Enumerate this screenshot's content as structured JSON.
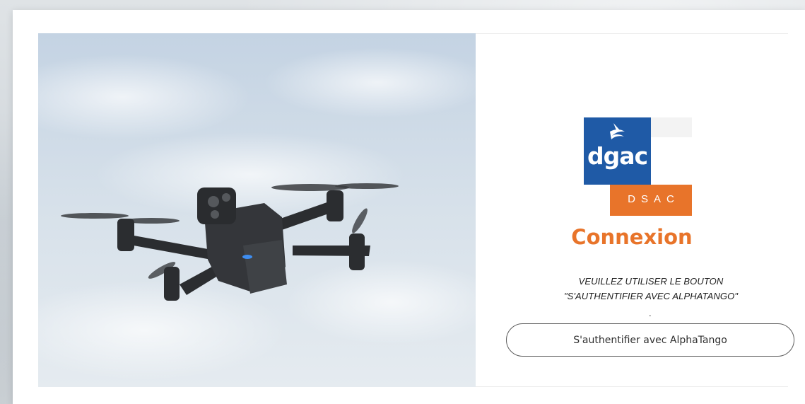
{
  "logo": {
    "primary_text": "dgac",
    "secondary_text": "DSAC",
    "colors": {
      "blue": "#1f5aa6",
      "orange": "#e8742a"
    }
  },
  "login": {
    "title": "Connexion",
    "instruction_line1": "VEUILLEZ UTILISER LE BOUTON",
    "instruction_line2": "\"S'AUTHENTIFIER AVEC ALPHATANGO\"",
    "dot": ".",
    "button_label": "S'authentifier avec AlphaTango"
  },
  "photo": {
    "subject_icon": "drone-photo"
  },
  "colors": {
    "accent": "#e8742a",
    "text": "#1d1d1d",
    "button_border": "#5d5d5d"
  }
}
